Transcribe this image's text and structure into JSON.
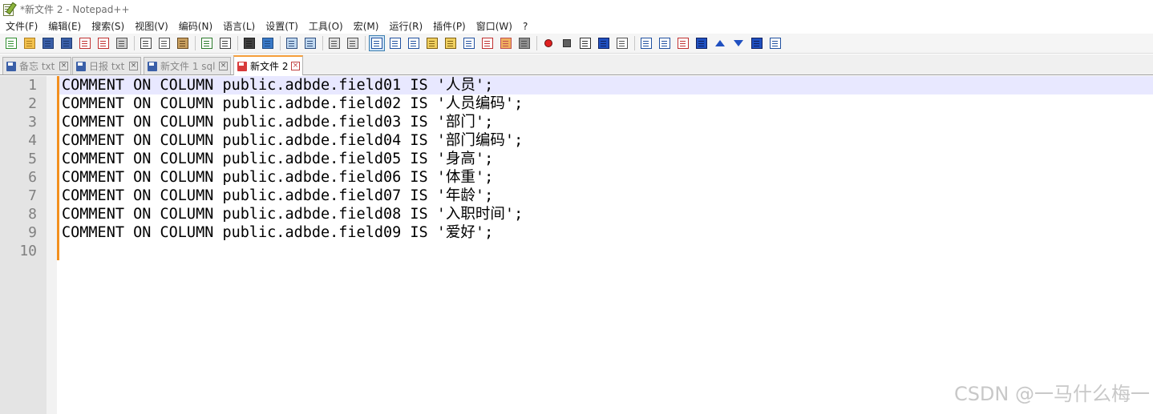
{
  "window": {
    "title": "*新文件 2 - Notepad++"
  },
  "menu": [
    "文件(F)",
    "编辑(E)",
    "搜索(S)",
    "视图(V)",
    "编码(N)",
    "语言(L)",
    "设置(T)",
    "工具(O)",
    "宏(M)",
    "运行(R)",
    "插件(P)",
    "窗口(W)",
    "?"
  ],
  "toolbar": {
    "groups": [
      [
        "new-file-icon",
        "open-file-icon",
        "save-icon",
        "save-all-icon",
        "close-icon",
        "close-all-icon",
        "print-icon"
      ],
      [
        "cut-icon",
        "copy-icon",
        "paste-icon"
      ],
      [
        "undo-icon",
        "redo-icon"
      ],
      [
        "find-icon",
        "replace-icon"
      ],
      [
        "zoom-in-icon",
        "zoom-out-icon"
      ],
      [
        "sync-vertical-icon",
        "sync-horizontal-icon"
      ],
      [
        "word-wrap-icon",
        "show-all-chars-icon",
        "indent-guide-icon",
        "user-language-icon",
        "document-map-icon",
        "document-list-icon",
        "function-list-icon",
        "folder-workspace-icon",
        "monitoring-icon"
      ],
      [
        "record-macro-icon",
        "stop-record-icon",
        "playback-macro-icon",
        "run-multiple-macro-icon",
        "save-macro-icon"
      ],
      [
        "insert-icon",
        "table-icon",
        "column-icon",
        "collapse-icon",
        "up-icon",
        "down-icon",
        "expand-icon",
        "panel-icon"
      ]
    ],
    "active": "word-wrap-icon"
  },
  "tabs": [
    {
      "label": "备忘 txt",
      "color": "#3a5fa8",
      "active": false
    },
    {
      "label": "日报 txt",
      "color": "#3a5fa8",
      "active": false
    },
    {
      "label": "新文件 1 sql",
      "color": "#3a5fa8",
      "active": false
    },
    {
      "label": "新文件 2",
      "color": "#d83b3b",
      "active": true
    }
  ],
  "editor": {
    "line_numbers": [
      "1",
      "2",
      "3",
      "4",
      "5",
      "6",
      "7",
      "8",
      "9",
      "10"
    ],
    "lines": [
      "COMMENT ON COLUMN public.adbde.field01 IS '人员';",
      "COMMENT ON COLUMN public.adbde.field02 IS '人员编码';",
      "COMMENT ON COLUMN public.adbde.field03 IS '部门';",
      "COMMENT ON COLUMN public.adbde.field04 IS '部门编码';",
      "COMMENT ON COLUMN public.adbde.field05 IS '身高';",
      "COMMENT ON COLUMN public.adbde.field06 IS '体重';",
      "COMMENT ON COLUMN public.adbde.field07 IS '年龄';",
      "COMMENT ON COLUMN public.adbde.field08 IS '入职时间';",
      "COMMENT ON COLUMN public.adbde.field09 IS '爱好';",
      ""
    ],
    "current_line": 1
  },
  "watermark": "CSDN @一马什么梅一",
  "colors": {
    "accent_orange": "#f28f1e",
    "current_line_bg": "#e8e8ff",
    "gutter_bg": "#e4e4e4"
  }
}
